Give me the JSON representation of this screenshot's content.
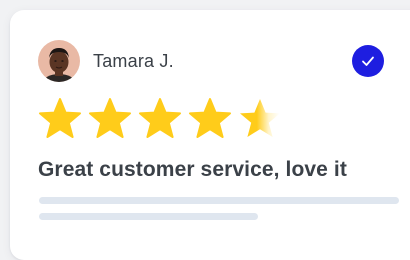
{
  "review": {
    "reviewer_name": "Tamara J.",
    "headline": "Great customer service, love it",
    "rating": 4.5,
    "max_rating": 5,
    "verified": true,
    "body_lines": [
      {
        "placeholder": true
      },
      {
        "placeholder": true
      }
    ]
  },
  "icons": {
    "avatar": "avatar-photo",
    "verified": "checkmark-icon",
    "star": "star-icon"
  },
  "colors": {
    "star_fill": "#ffcc1a",
    "star_empty": "#fff4cc",
    "verified_badge": "#1e1ee0",
    "text": "#3b4148",
    "placeholder_line": "#dfe6ef"
  }
}
